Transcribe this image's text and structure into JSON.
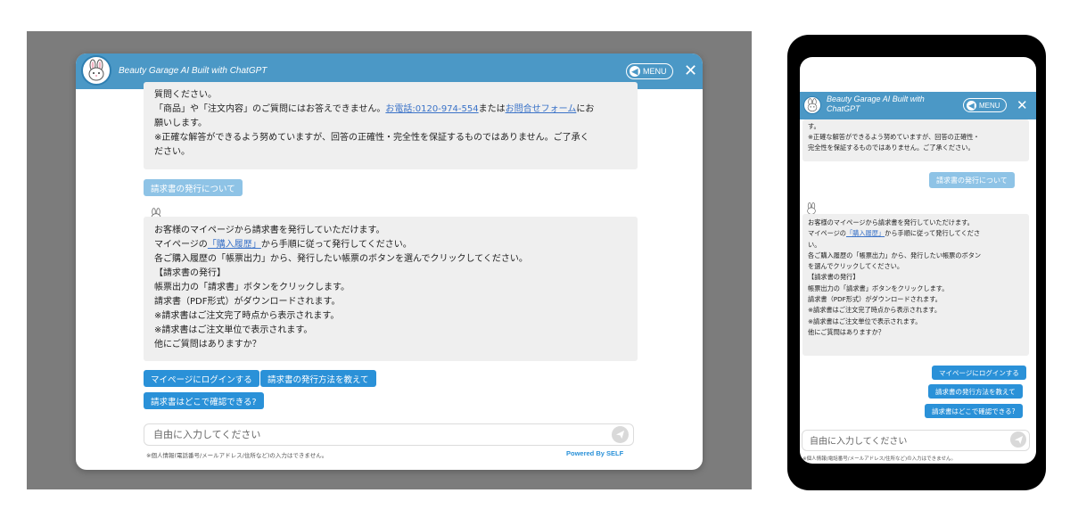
{
  "header": {
    "title": "Beauty Garage AI Built with ChatGPT",
    "title_line1": "Beauty Garage AI Built with",
    "title_line2": "ChatGPT",
    "menu_label": "MENU",
    "close_symbol": "✕"
  },
  "conversation": {
    "intro_lines": {
      "line1": "質問ください。",
      "line2_pre": "「商品」や「注文内容」のご質問にはお答えできません。",
      "phone_link": "お電話:0120-974-554",
      "line2_mid": "または",
      "form_link": "お問合せフォーム",
      "line2_post": "にお",
      "line3": "願いします。",
      "line4": "※正確な解答ができるよう努めていますが、回答の正確性・完全性を保証するものではありません。ご了承く",
      "line5": "ださい。"
    },
    "mobile_intro_lines": [
      "す。",
      "※正確な解答ができるよう努めていますが、回答の正確性・",
      "完全性を保証するものではありません。ご了承ください。"
    ],
    "user_message": "請求書の発行について",
    "bot_reply": {
      "line1": "お客様のマイページから請求書を発行していただけます。",
      "line2_pre": "マイページの",
      "history_link": "「購入履歴」",
      "line2_post": "から手順に従って発行してください。",
      "line3": "各ご購入履歴の「帳票出力」から、発行したい帳票のボタンを選んでクリックしてください。",
      "line4": "【請求書の発行】",
      "line5": "帳票出力の「請求書」ボタンをクリックします。",
      "line6": "請求書（PDF形式）がダウンロードされます。",
      "line7": "※請求書はご注文完了時点から表示されます。",
      "line8": "※請求書はご注文単位で表示されます。",
      "line9": "他にご質問はありますか？"
    },
    "mobile_bot_reply": {
      "line1": "お客様のマイページから請求書を発行していただけます。",
      "line2_pre": "マイページの",
      "history_link": "「購入履歴」",
      "line2_post": "から手順に従って発行してくださ",
      "line3": "い。",
      "line4": "各ご購入履歴の「帳票出力」から、発行したい帳票のボタン",
      "line5": "を選んでクリックしてください。",
      "line6": "【請求書の発行】",
      "line7": "帳票出力の「請求書」ボタンをクリックします。",
      "line8": "請求書（PDF形式）がダウンロードされます。",
      "line9": "※請求書はご注文完了時点から表示されます。",
      "line10": "※請求書はご注文単位で表示されます。",
      "line11": "他にご質問はありますか？"
    },
    "suggestions": [
      "マイページにログインする",
      "請求書の発行方法を教えて",
      "請求書はどこで確認できる?"
    ]
  },
  "input": {
    "placeholder": "自由に入力してください"
  },
  "footer": {
    "notice": "※個人情報(電話番号/メールアドレス/住所など)の入力はできません。",
    "powered_by": "Powered By SELF"
  },
  "colors": {
    "header": "#4b98c6",
    "suggestion_button": "#2a91d8",
    "user_bubble": "#8ec3e6",
    "bot_bubble": "#efefef",
    "backdrop": "#7c7c7c"
  },
  "icons": {
    "avatar": "bunny-mascot-icon",
    "menu_arrow": "back-arrow-icon",
    "send": "send-paper-plane-icon"
  }
}
